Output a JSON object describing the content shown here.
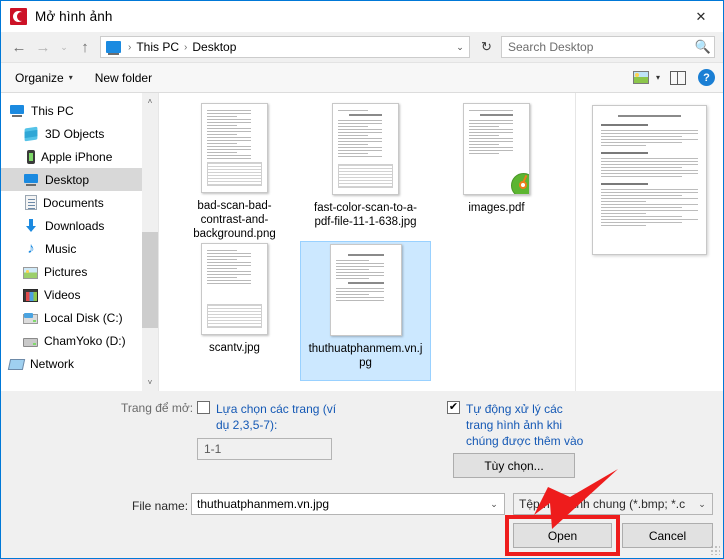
{
  "window": {
    "title": "Mở hình ảnh",
    "app_icon": "camera-icon",
    "close_label": "✕",
    "accent_color": "#0078d7"
  },
  "nav": {
    "back": "←",
    "forward": "→",
    "recent": "⌄",
    "up": "↑",
    "breadcrumb": [
      "This PC",
      "Desktop"
    ],
    "separator": "›",
    "dropdown": "⌄",
    "refresh": "↻"
  },
  "search": {
    "placeholder": "Search Desktop",
    "value": "",
    "icon": "search-icon"
  },
  "toolbar": {
    "organize": "Organize",
    "new_folder": "New folder",
    "caret": "▾",
    "view_icon": "image-view-icon",
    "pane_icon": "preview-pane-icon",
    "help": "?"
  },
  "sidebar": {
    "items": [
      {
        "label": "This PC",
        "icon": "computer-icon",
        "indent": false,
        "selected": false,
        "ico_class": "ico-pc"
      },
      {
        "label": "3D Objects",
        "icon": "cube-icon",
        "indent": true,
        "selected": false,
        "ico_class": "ico-3d"
      },
      {
        "label": "Apple iPhone",
        "icon": "phone-icon",
        "indent": true,
        "selected": false,
        "ico_class": "ico-phone"
      },
      {
        "label": "Desktop",
        "icon": "desktop-icon",
        "indent": true,
        "selected": true,
        "ico_class": "ico-desktop"
      },
      {
        "label": "Documents",
        "icon": "documents-icon",
        "indent": true,
        "selected": false,
        "ico_class": "ico-doc"
      },
      {
        "label": "Downloads",
        "icon": "download-icon",
        "indent": true,
        "selected": false,
        "ico_class": "ico-dl"
      },
      {
        "label": "Music",
        "icon": "music-note-icon",
        "indent": true,
        "selected": false,
        "ico_class": "ico-music"
      },
      {
        "label": "Pictures",
        "icon": "pictures-icon",
        "indent": true,
        "selected": false,
        "ico_class": "ico-pic"
      },
      {
        "label": "Videos",
        "icon": "videos-icon",
        "indent": true,
        "selected": false,
        "ico_class": "ico-vid"
      },
      {
        "label": "Local Disk (C:)",
        "icon": "hard-disk-icon",
        "indent": true,
        "selected": false,
        "ico_class": "ico-disk"
      },
      {
        "label": "ChamYoko (D:)",
        "icon": "hard-disk-icon",
        "indent": true,
        "selected": false,
        "ico_class": "ico-disk2"
      },
      {
        "label": "Network",
        "icon": "network-icon",
        "indent": false,
        "selected": false,
        "ico_class": "ico-net"
      }
    ],
    "scroll_up": "˄",
    "scroll_down": "˅"
  },
  "files": [
    {
      "name": "bad-scan-bad-contrast-and-background.png",
      "type": "png",
      "selected": false
    },
    {
      "name": "fast-color-scan-to-a-pdf-file-11-1-638.jpg",
      "type": "jpg",
      "selected": false
    },
    {
      "name": "images.pdf",
      "type": "pdf",
      "selected": false
    },
    {
      "name": "scantv.jpg",
      "type": "jpg",
      "selected": false
    },
    {
      "name": "thuthuatphanmem.vn.jpg",
      "type": "jpg",
      "selected": true
    }
  ],
  "options": {
    "pages_to_open_label": "Trang để mở:",
    "select_pages_label": "Lựa chọn các trang (ví dụ 2,3,5-7):",
    "select_pages_checked": false,
    "pages_value": "1-1",
    "auto_process_label": "Tự động xử lý các trang hình ảnh khi chúng được thêm vào",
    "auto_process_checked": true,
    "options_button": "Tùy chọn..."
  },
  "footer": {
    "file_name_label": "File name:",
    "file_name_value": "thuthuatphanmem.vn.jpg",
    "file_type_value": "Tệp hình ảnh chung (*.bmp; *.c",
    "dropdown_caret": "⌄",
    "open_button": "Open",
    "cancel_button": "Cancel",
    "highlight_color": "#ee1c1c"
  }
}
